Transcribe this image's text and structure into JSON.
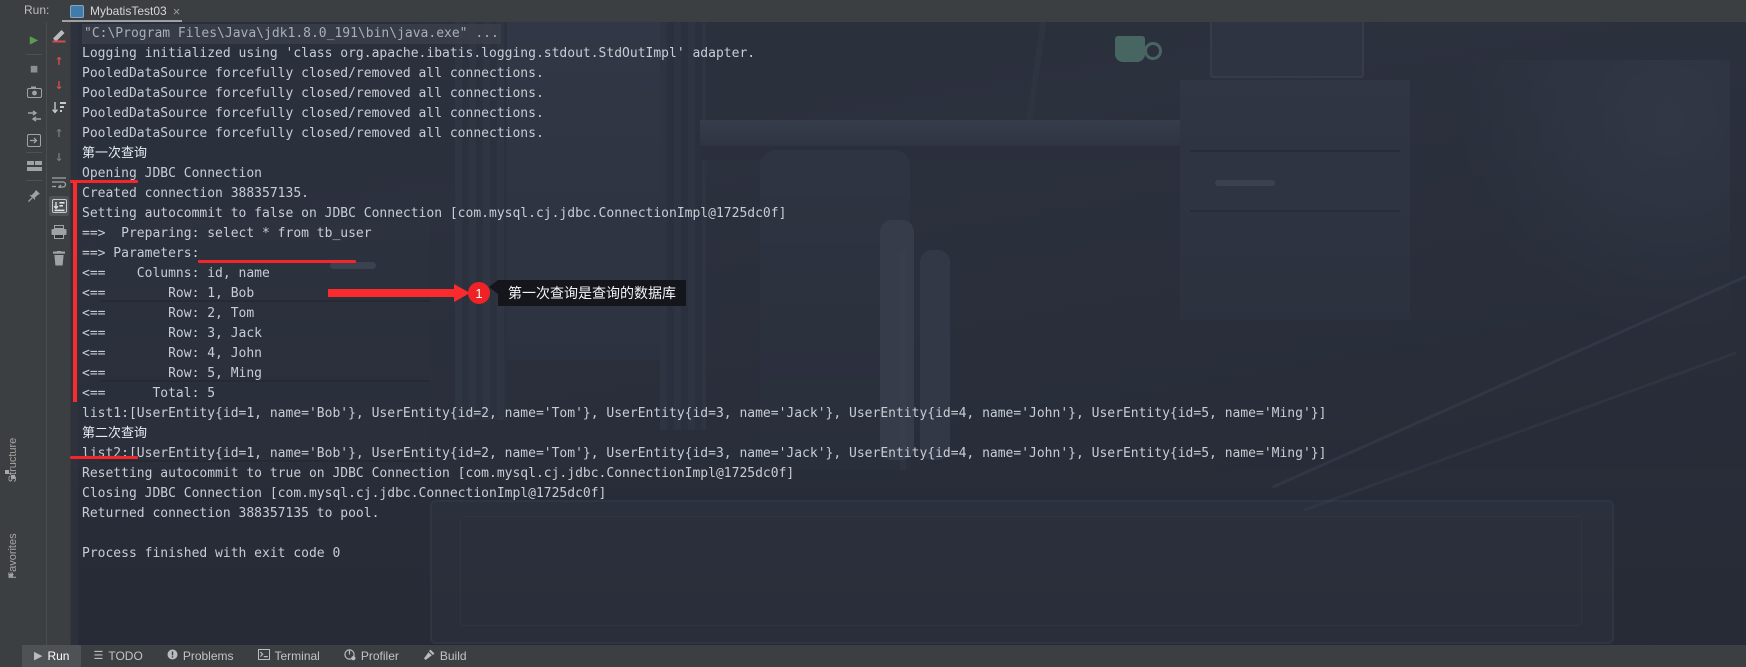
{
  "window": {
    "run_label": "Run:",
    "tab_title": "MybatisTest03",
    "tab_icon": "run-config-icon",
    "close_icon": "×"
  },
  "left_rail": {
    "structure_label": "Structure",
    "favorites_label": "Favorites",
    "structure_icon": "structure-icon",
    "favorites_icon": "★"
  },
  "toolbar_primary": [
    {
      "name": "rerun",
      "glyph": "▶",
      "color": "#5a9e4b",
      "selected": false
    },
    {
      "name": "stop",
      "glyph": "■",
      "color": "#8c9096",
      "selected": false
    },
    {
      "name": "screenshot",
      "glyph": "▣",
      "color": "#9fa3a8",
      "selected": false
    },
    {
      "name": "export-threads",
      "glyph": "⇄",
      "color": "#9fa3a8",
      "selected": false
    },
    {
      "name": "attach-debugger",
      "glyph": "⮌",
      "color": "#9fa3a8",
      "selected": false
    },
    {
      "name": "layout",
      "glyph": "▤",
      "color": "#9fa3a8",
      "selected": false
    },
    {
      "name": "pin-tab",
      "glyph": "📌",
      "color": "#9fa3a8",
      "selected": false
    }
  ],
  "toolbar_secondary": [
    {
      "name": "edit-configuration",
      "glyph": "✎",
      "color": "#d44b4b",
      "selected": false
    },
    {
      "name": "previous-occurrence",
      "glyph": "↑",
      "color": "#e2524f",
      "selected": false
    },
    {
      "name": "next-occurrence",
      "glyph": "↓",
      "color": "#e2524f",
      "selected": false
    },
    {
      "name": "soft-wrap",
      "glyph": "↓≡",
      "color": "#9fa3a8",
      "selected": false
    },
    {
      "name": "scroll-up",
      "glyph": "↑",
      "color": "#7c8086",
      "selected": false
    },
    {
      "name": "scroll-down",
      "glyph": "↓",
      "color": "#7c8086",
      "selected": false
    },
    {
      "name": "use-soft-wraps",
      "glyph": "↵",
      "color": "#9fa3a8",
      "selected": false
    },
    {
      "name": "scroll-to-end",
      "glyph": "⤓",
      "color": "#c6cad0",
      "selected": true
    },
    {
      "name": "print",
      "glyph": "⎙",
      "color": "#9fa3a8",
      "selected": false
    },
    {
      "name": "clear-all",
      "glyph": "🗑",
      "color": "#9fa3a8",
      "selected": false
    }
  ],
  "console": {
    "lines": [
      {
        "text": "\"C:\\Program Files\\Java\\jdk1.8.0_191\\bin\\java.exe\" ...",
        "kind": "cmd"
      },
      {
        "text": "Logging initialized using 'class org.apache.ibatis.logging.stdout.StdOutImpl' adapter.",
        "kind": "out"
      },
      {
        "text": "PooledDataSource forcefully closed/removed all connections.",
        "kind": "out"
      },
      {
        "text": "PooledDataSource forcefully closed/removed all connections.",
        "kind": "out"
      },
      {
        "text": "PooledDataSource forcefully closed/removed all connections.",
        "kind": "out"
      },
      {
        "text": "PooledDataSource forcefully closed/removed all connections.",
        "kind": "out"
      },
      {
        "text": "第一次查询",
        "kind": "anno"
      },
      {
        "text": "Opening JDBC Connection",
        "kind": "out"
      },
      {
        "text": "Created connection 388357135.",
        "kind": "out"
      },
      {
        "text": "Setting autocommit to false on JDBC Connection [com.mysql.cj.jdbc.ConnectionImpl@1725dc0f]",
        "kind": "out"
      },
      {
        "text": "==>  Preparing: select * from tb_user",
        "kind": "out"
      },
      {
        "text": "==> Parameters: ",
        "kind": "out"
      },
      {
        "text": "<==    Columns: id, name",
        "kind": "out"
      },
      {
        "text": "<==        Row: 1, Bob",
        "kind": "out"
      },
      {
        "text": "<==        Row: 2, Tom",
        "kind": "out"
      },
      {
        "text": "<==        Row: 3, Jack",
        "kind": "out"
      },
      {
        "text": "<==        Row: 4, John",
        "kind": "out"
      },
      {
        "text": "<==        Row: 5, Ming",
        "kind": "out"
      },
      {
        "text": "<==      Total: 5",
        "kind": "out"
      },
      {
        "text": "list1:[UserEntity{id=1, name='Bob'}, UserEntity{id=2, name='Tom'}, UserEntity{id=3, name='Jack'}, UserEntity{id=4, name='John'}, UserEntity{id=5, name='Ming'}]",
        "kind": "out"
      },
      {
        "text": "第二次查询",
        "kind": "anno"
      },
      {
        "text": "list2:[UserEntity{id=1, name='Bob'}, UserEntity{id=2, name='Tom'}, UserEntity{id=3, name='Jack'}, UserEntity{id=4, name='John'}, UserEntity{id=5, name='Ming'}]",
        "kind": "out"
      },
      {
        "text": "Resetting autocommit to true on JDBC Connection [com.mysql.cj.jdbc.ConnectionImpl@1725dc0f]",
        "kind": "out"
      },
      {
        "text": "Closing JDBC Connection [com.mysql.cj.jdbc.ConnectionImpl@1725dc0f]",
        "kind": "out"
      },
      {
        "text": "Returned connection 388357135 to pool.",
        "kind": "out"
      },
      {
        "text": " ",
        "kind": "blank"
      },
      {
        "text": "Process finished with exit code 0",
        "kind": "out"
      }
    ]
  },
  "annotations": {
    "accent_color": "#fb2a2d",
    "callout": {
      "number": "1",
      "text": "第一次查询是查询的数据库"
    }
  },
  "bottom_bar": {
    "items": [
      {
        "label": "Run",
        "icon": "play-icon",
        "glyph": "▶",
        "active": true
      },
      {
        "label": "TODO",
        "icon": "todo-list-icon",
        "glyph": "☰",
        "active": false
      },
      {
        "label": "Problems",
        "icon": "problems-icon",
        "glyph": "❗",
        "active": false
      },
      {
        "label": "Terminal",
        "icon": "terminal-icon",
        "glyph": "⌨",
        "active": false
      },
      {
        "label": "Profiler",
        "icon": "profiler-icon",
        "glyph": "◔",
        "active": false
      },
      {
        "label": "Build",
        "icon": "build-hammer-icon",
        "glyph": "⚒",
        "active": false
      }
    ]
  }
}
